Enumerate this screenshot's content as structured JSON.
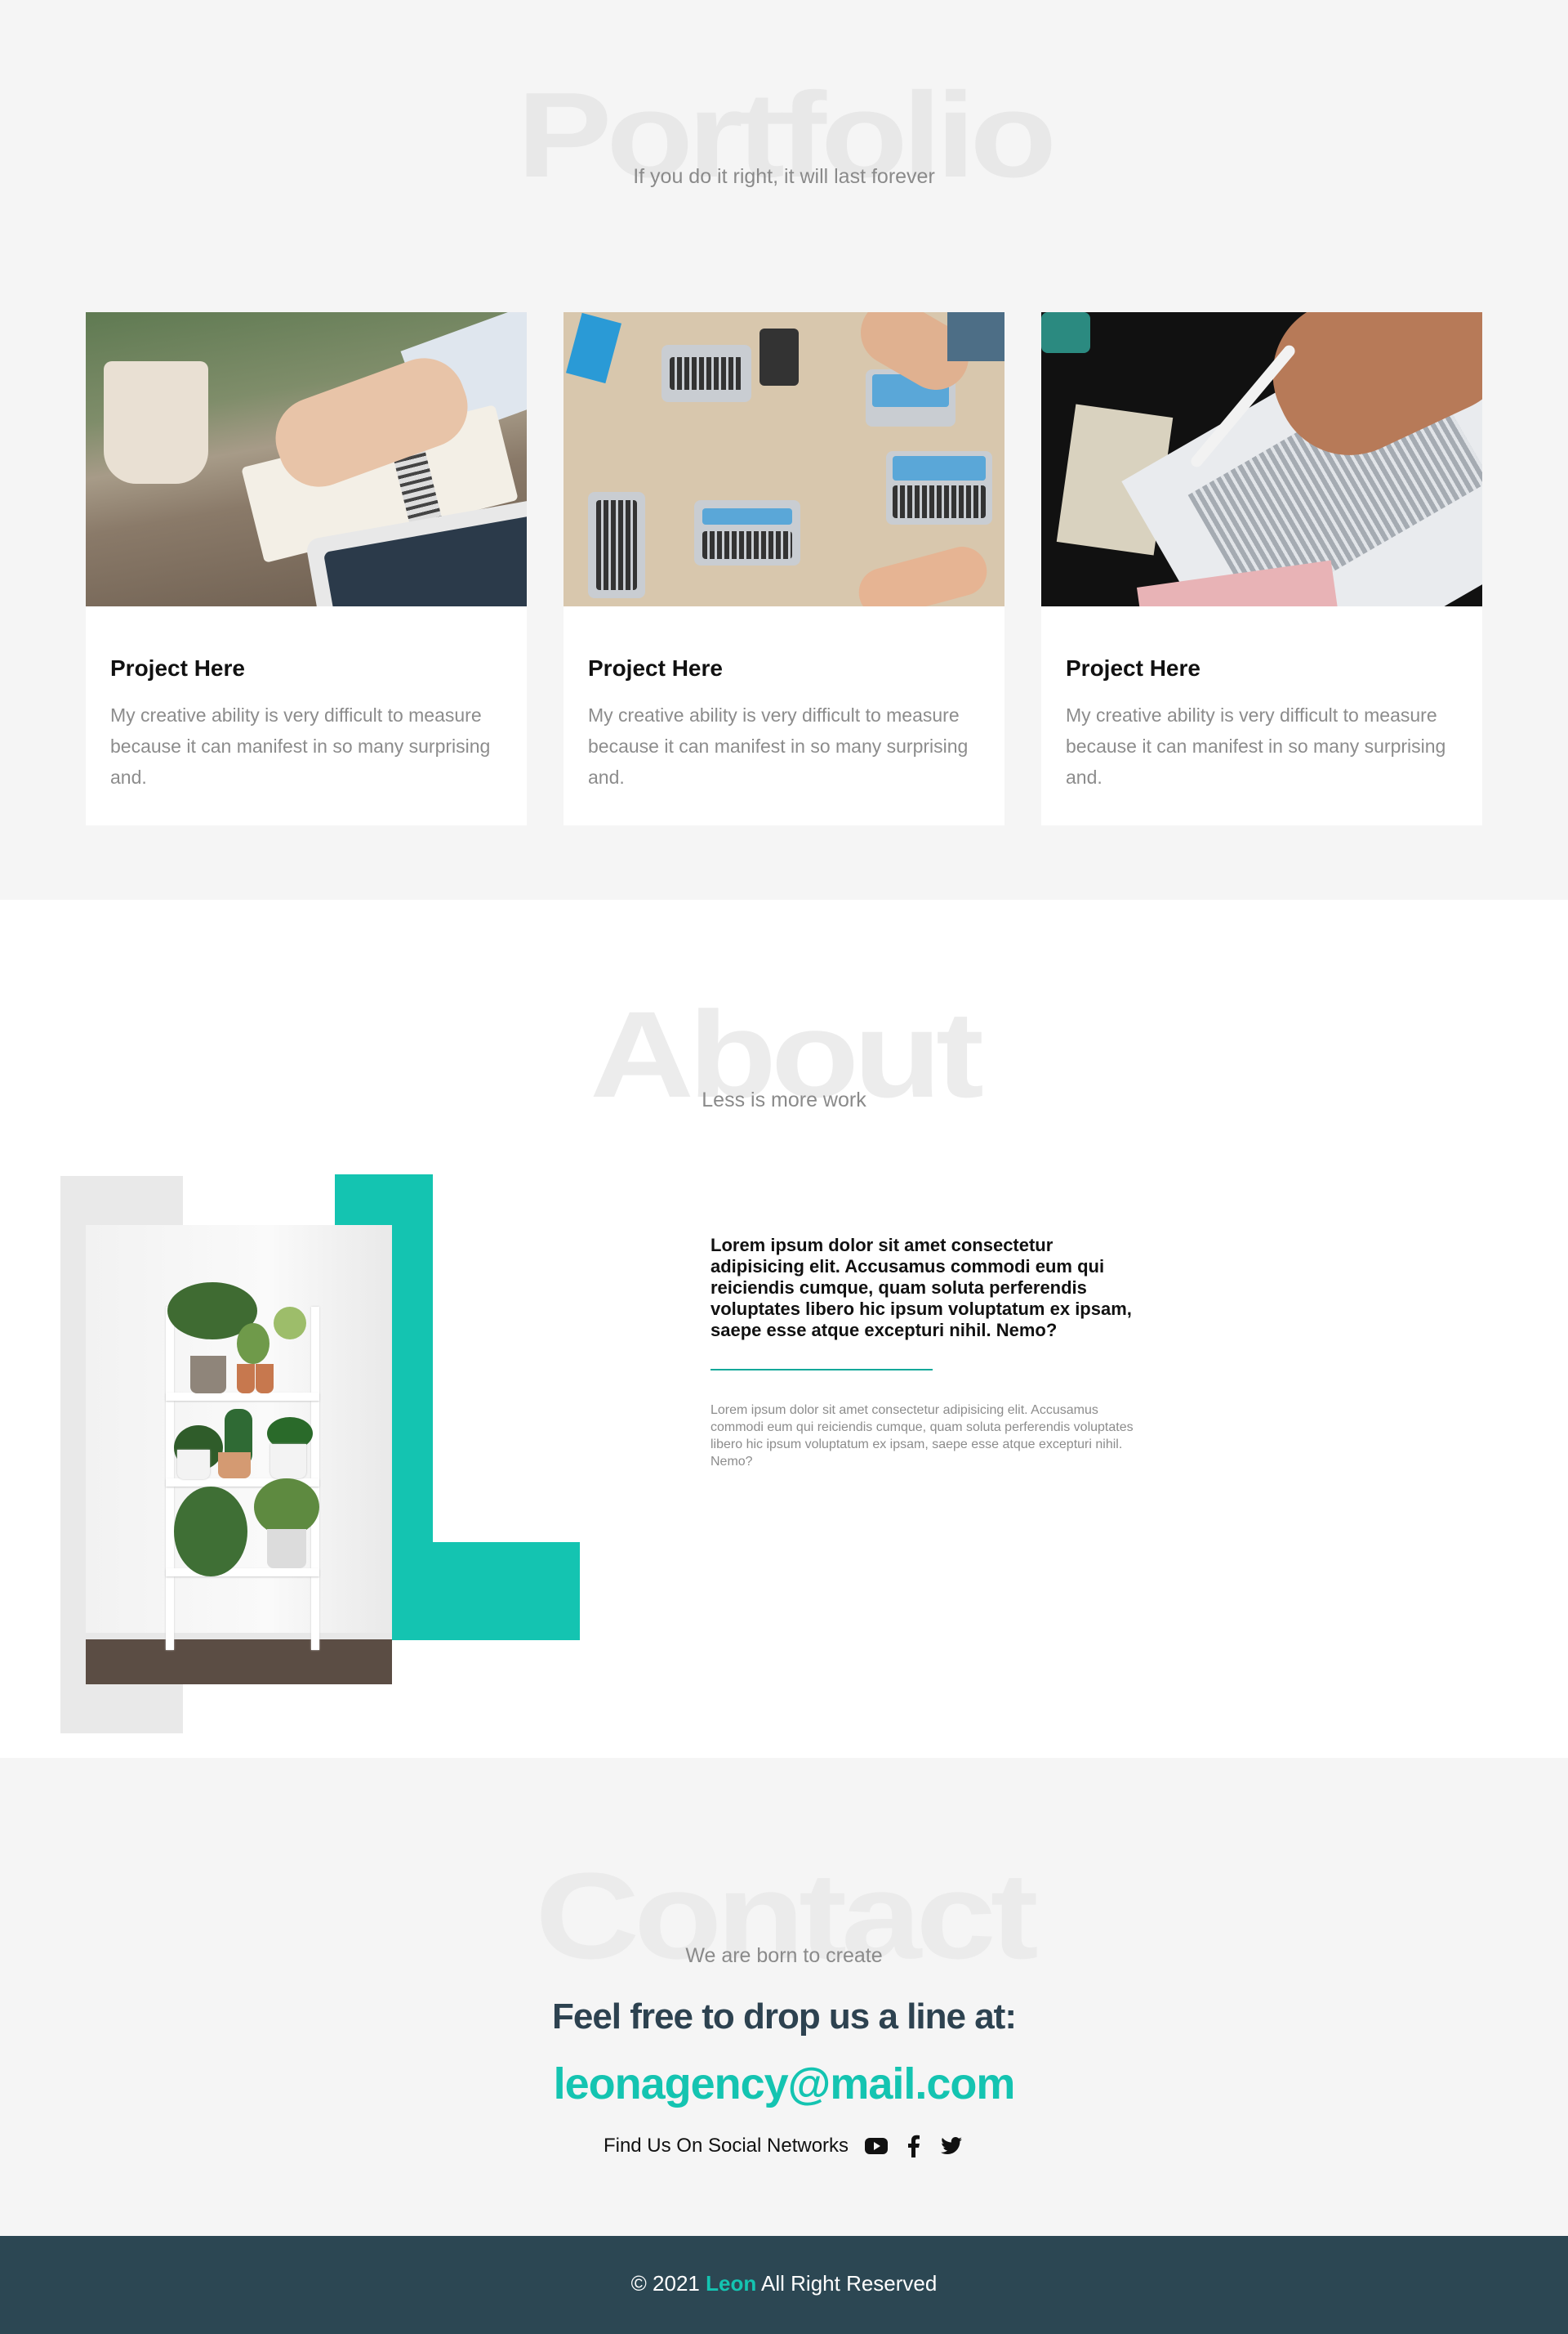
{
  "portfolio": {
    "big_title": "Portfolio",
    "subtitle": "If you do it right, it will last forever",
    "cards": [
      {
        "title": "Project Here",
        "text": "My creative ability is very difficult to measure because it can manifest in so many surprising and."
      },
      {
        "title": "Project Here",
        "text": "My creative ability is very difficult to measure because it can manifest in so many surprising and."
      },
      {
        "title": "Project Here",
        "text": "My creative ability is very difficult to measure because it can manifest in so many surprising and."
      }
    ]
  },
  "about": {
    "big_title": "About",
    "subtitle": "Less is more work",
    "lead": "Lorem ipsum dolor sit amet consectetur adipisicing elit. Accusamus commodi eum qui reiciendis cumque, quam soluta perferendis voluptates libero hic ipsum voluptatum ex ipsam, saepe esse atque excepturi nihil. Nemo?",
    "body": "Lorem ipsum dolor sit amet consectetur adipisicing elit. Accusamus commodi eum qui reiciendis cumque, quam soluta perferendis voluptates libero hic ipsum voluptatum ex ipsam, saepe esse atque excepturi nihil. Nemo?"
  },
  "contact": {
    "big_title": "Contact",
    "subtitle": "We are born to create",
    "cta_line": "Feel free to drop us a line at:",
    "email": "leonagency@mail.com",
    "social_label": "Find Us On Social Networks",
    "social_icons": [
      "youtube-icon",
      "facebook-icon",
      "twitter-icon"
    ]
  },
  "footer": {
    "copy_prefix": "© 2021",
    "brand": "Leon",
    "copy_suffix": "All Right Reserved"
  },
  "colors": {
    "accent": "#14c4b1",
    "dark": "#2c4753",
    "heading_dark": "#2d4250",
    "muted_text": "#8c8c8c",
    "section_gray": "#f5f5f5"
  }
}
